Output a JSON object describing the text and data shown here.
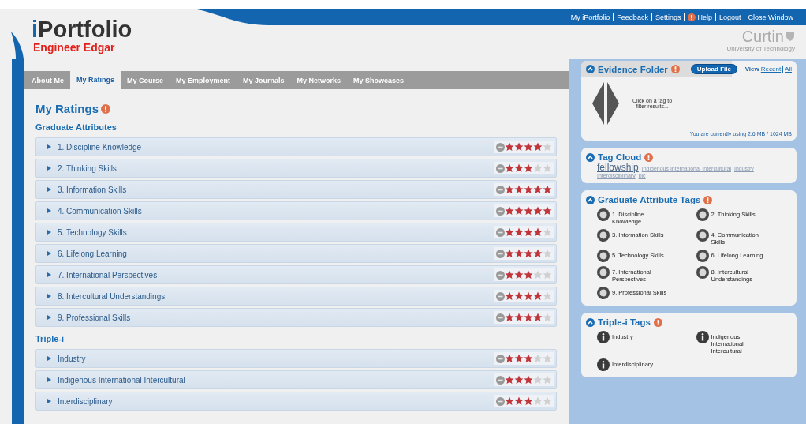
{
  "header": {
    "logo_prefix": "i",
    "logo_text": "Portfolio",
    "user_name": "Engineer Edgar",
    "top_links": [
      {
        "label": "My iPortfolio",
        "kind": "link"
      },
      {
        "label": "Feedback",
        "kind": "link"
      },
      {
        "label": "Settings",
        "kind": "link"
      },
      {
        "label": "Help",
        "kind": "help"
      },
      {
        "label": "Logout",
        "kind": "link"
      },
      {
        "label": "Close Window",
        "kind": "link"
      }
    ],
    "university": {
      "name": "Curtin",
      "subtitle": "University of Technology"
    }
  },
  "tabs": [
    {
      "label": "About Me",
      "selected": false
    },
    {
      "label": "My Ratings",
      "selected": true
    },
    {
      "label": "My Course",
      "selected": false
    },
    {
      "label": "My Employment",
      "selected": false
    },
    {
      "label": "My Journals",
      "selected": false
    },
    {
      "label": "My Networks",
      "selected": false
    },
    {
      "label": "My Showcases",
      "selected": false
    }
  ],
  "page_title": "My Ratings",
  "sections": [
    {
      "title": "Graduate Attributes",
      "items": [
        {
          "label": "1. Discipline Knowledge",
          "stars": 4
        },
        {
          "label": "2. Thinking Skills",
          "stars": 3
        },
        {
          "label": "3. Information Skills",
          "stars": 5
        },
        {
          "label": "4. Communication Skills",
          "stars": 5
        },
        {
          "label": "5. Technology Skills",
          "stars": 4
        },
        {
          "label": "6. Lifelong Learning",
          "stars": 4
        },
        {
          "label": "7. International Perspectives",
          "stars": 3
        },
        {
          "label": "8. Intercultural Understandings",
          "stars": 4
        },
        {
          "label": "9. Professional Skills",
          "stars": 4
        }
      ]
    },
    {
      "title": "Triple-i",
      "items": [
        {
          "label": "Industry",
          "stars": 3
        },
        {
          "label": "Indigenous International Intercultural",
          "stars": 3
        },
        {
          "label": "Interdisciplinary",
          "stars": 3
        }
      ]
    }
  ],
  "evidence_folder": {
    "title": "Evidence Folder",
    "upload_button": "Upload File",
    "view_label": "View",
    "view_links": [
      "Recent",
      "All"
    ],
    "hint": "Click on a tag to filter results...",
    "usage": "You are currently using 2.6 MB / 1024 MB"
  },
  "tag_cloud": {
    "title": "Tag Cloud",
    "tags": [
      {
        "label": "fellowship",
        "large": true
      },
      {
        "label": "Indigenous International Intercultural",
        "large": false
      },
      {
        "label": "Industry",
        "large": false
      },
      {
        "label": "Interdisciplinary",
        "large": false
      },
      {
        "label": "plc",
        "large": false
      }
    ]
  },
  "graduate_attribute_tags": {
    "title": "Graduate Attribute Tags",
    "tags": [
      "1. Discipline Knowledge",
      "2. Thinking Skills",
      "3. Information Skills",
      "4. Communication Skills",
      "5. Technology Skills",
      "6. Lifelong Learning",
      "7. International Perspectives",
      "8. Intercultural Understandings",
      "9. Professional Skills"
    ]
  },
  "triple_i_tags": {
    "title": "Triple-i Tags",
    "tags": [
      "Industry",
      "Indigenous International Intercultural",
      "Interdisciplinary"
    ]
  }
}
